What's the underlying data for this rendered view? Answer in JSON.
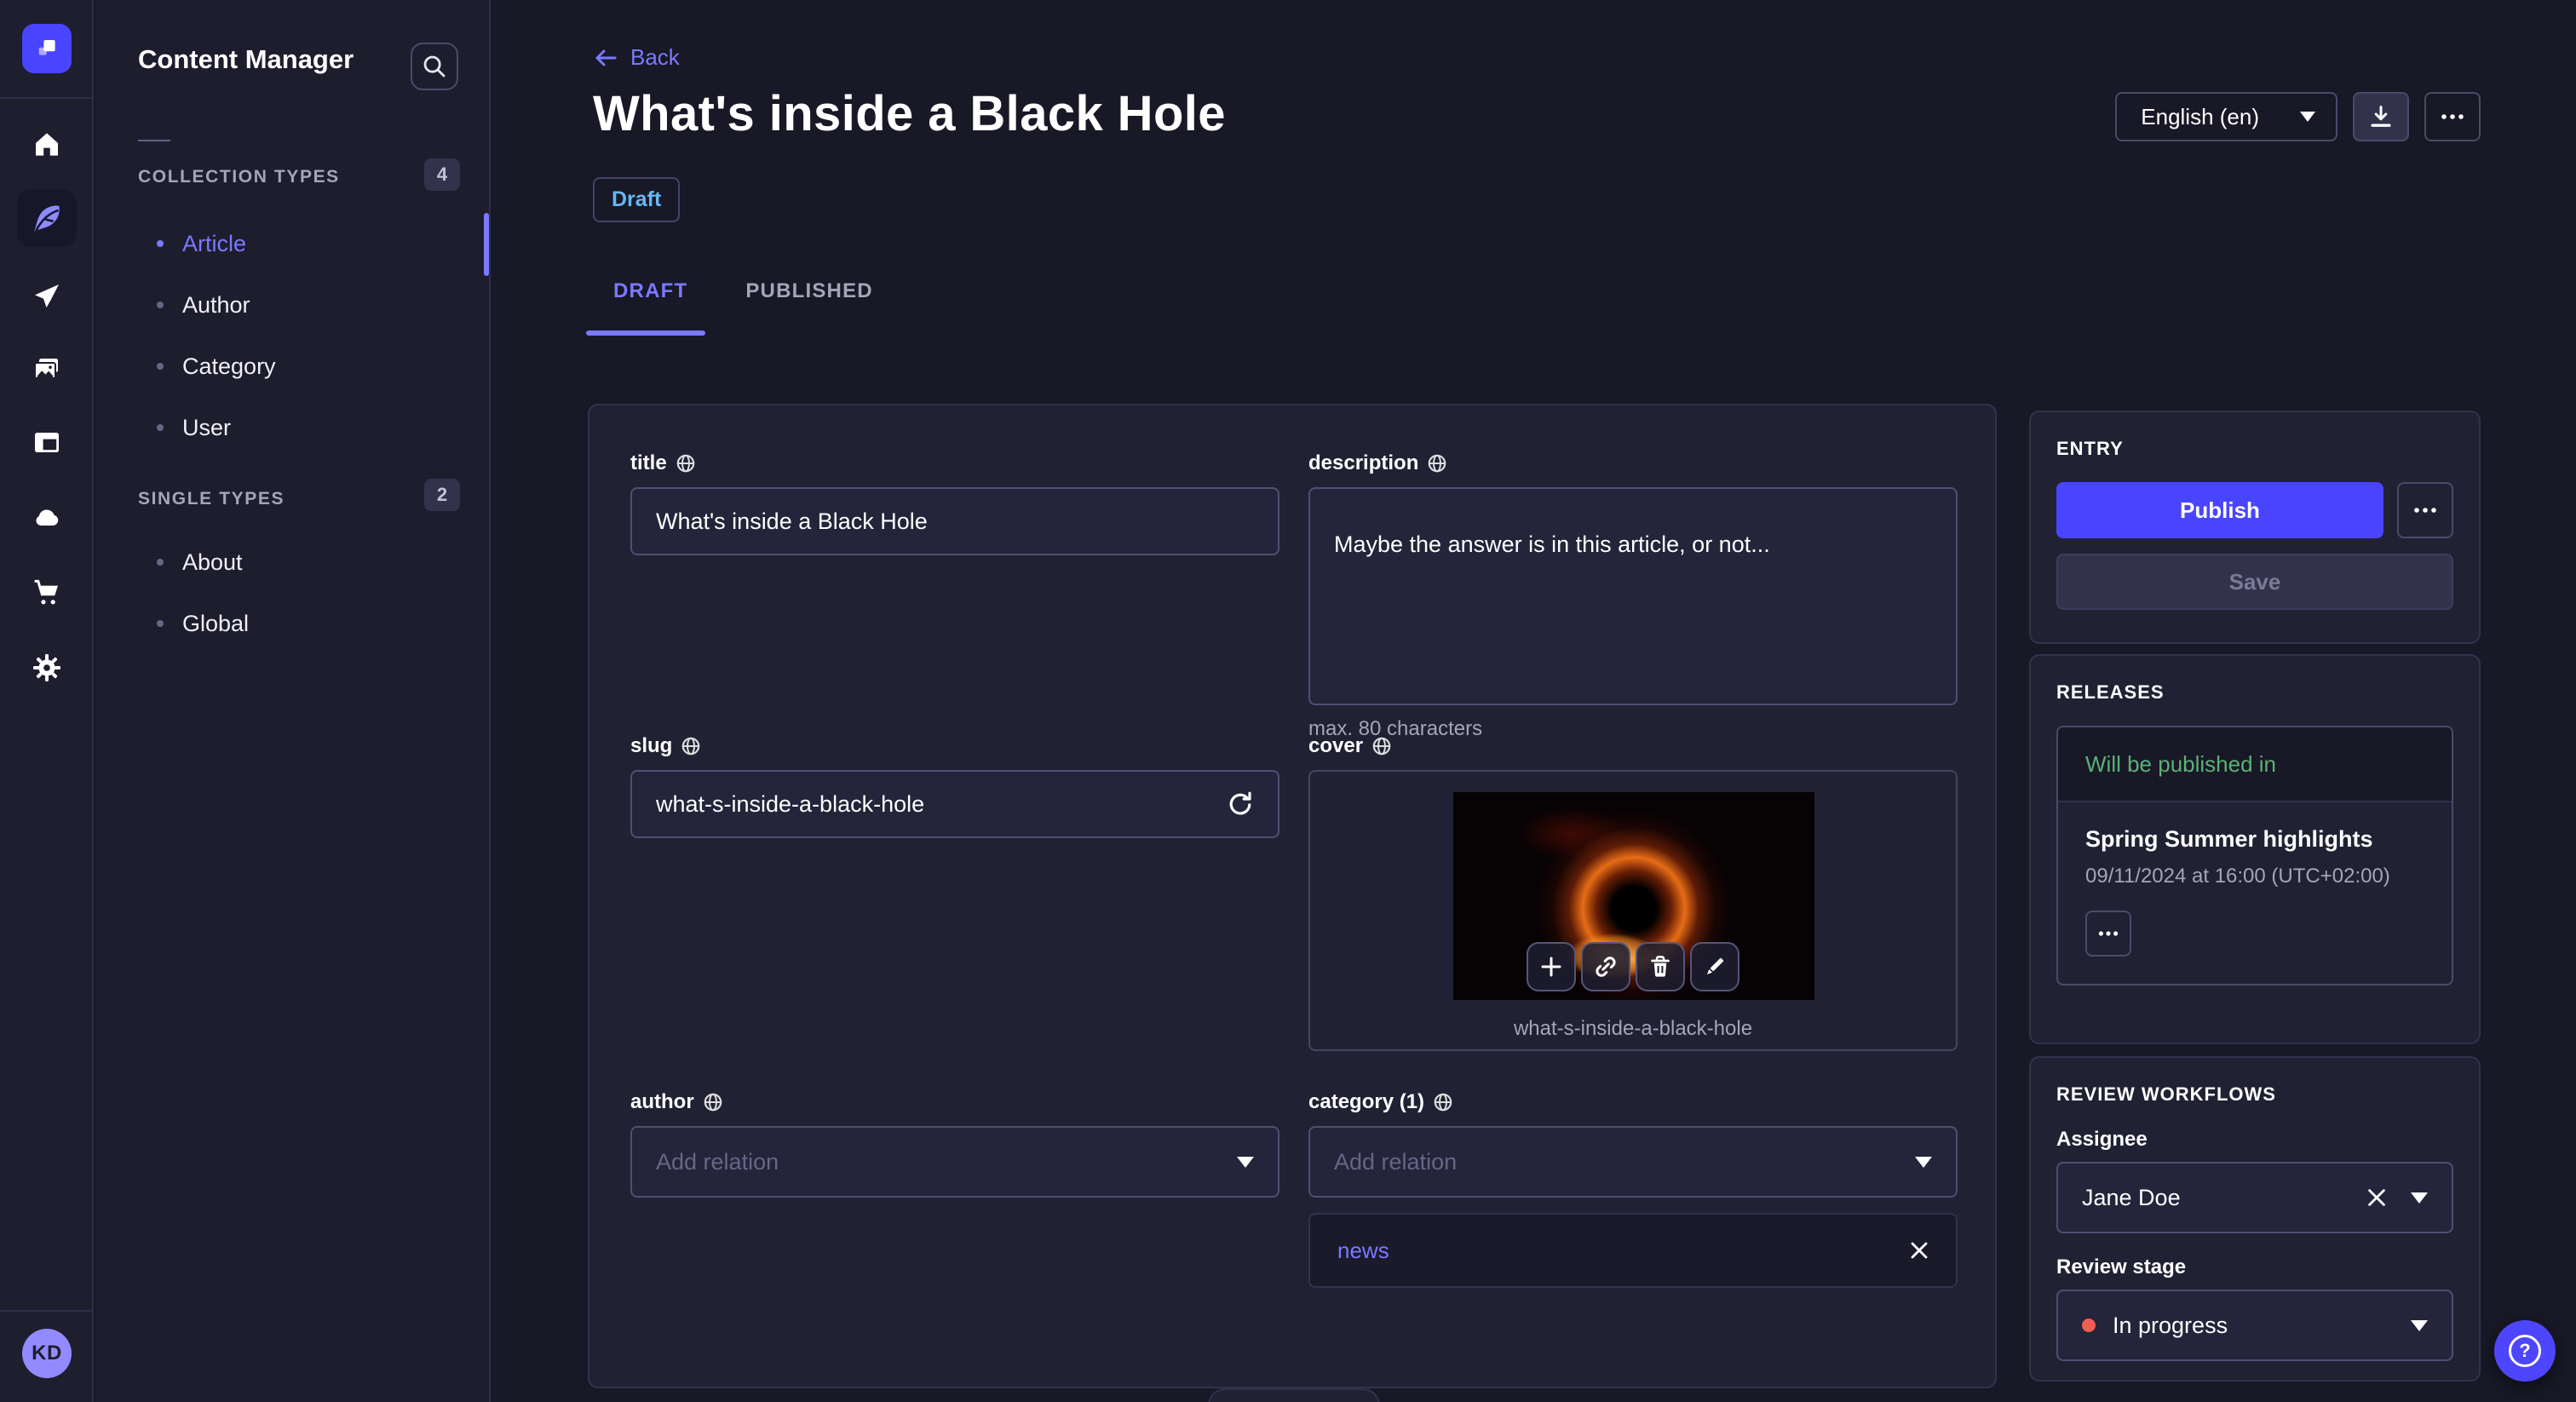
{
  "app": {
    "name": "Content Manager"
  },
  "user": {
    "initials": "KD"
  },
  "sidebar": {
    "title": "Content Manager",
    "sections": [
      {
        "label": "COLLECTION TYPES",
        "badge": "4",
        "items": [
          {
            "label": "Article"
          },
          {
            "label": "Author"
          },
          {
            "label": "Category"
          },
          {
            "label": "User"
          }
        ]
      },
      {
        "label": "SINGLE TYPES",
        "badge": "2",
        "items": [
          {
            "label": "About"
          },
          {
            "label": "Global"
          }
        ]
      }
    ]
  },
  "header": {
    "back": "Back",
    "title": "What's inside a Black Hole",
    "status": "Draft",
    "locale": "English (en)"
  },
  "tabs": [
    {
      "label": "DRAFT"
    },
    {
      "label": "PUBLISHED"
    }
  ],
  "form": {
    "title": {
      "label": "title",
      "value": "What's inside a Black Hole"
    },
    "description": {
      "label": "description",
      "value": "Maybe the answer is in this article, or not...",
      "hint": "max. 80 characters"
    },
    "slug": {
      "label": "slug",
      "value": "what-s-inside-a-black-hole"
    },
    "cover": {
      "label": "cover",
      "caption": "what-s-inside-a-black-hole"
    },
    "author": {
      "label": "author",
      "placeholder": "Add relation"
    },
    "category": {
      "label": "category (1)",
      "placeholder": "Add relation",
      "relations": [
        {
          "label": "news"
        }
      ]
    }
  },
  "entry": {
    "heading": "ENTRY",
    "publish_label": "Publish",
    "save_label": "Save"
  },
  "releases": {
    "heading": "RELEASES",
    "status": "Will be published in",
    "name": "Spring Summer highlights",
    "date": "09/11/2024 at 16:00 (UTC+02:00)"
  },
  "review": {
    "heading": "REVIEW WORKFLOWS",
    "assignee_label": "Assignee",
    "assignee_value": "Jane Doe",
    "stage_label": "Review stage",
    "stage_value": "In progress"
  },
  "help": {
    "label": "?"
  },
  "icons": {
    "rail": [
      "home-icon",
      "feather-icon",
      "paper-plane-icon",
      "media-library-icon",
      "content-type-builder-icon",
      "cloud-icon",
      "marketplace-cart-icon",
      "settings-gear-icon"
    ],
    "other": [
      "search-icon",
      "back-arrow-icon",
      "caret-down-icon",
      "download-icon",
      "more-dots-icon",
      "globe-i18n-icon",
      "refresh-icon",
      "plus-icon",
      "link-icon",
      "trash-icon",
      "pencil-icon",
      "close-x-icon",
      "question-icon"
    ]
  },
  "colors": {
    "accent": "#4945ff",
    "link": "#7b79ff",
    "draft_status": "#66b7f1",
    "success": "#5cb176",
    "danger": "#ee5e52",
    "page_bg": "#181826",
    "card_bg": "#212134"
  }
}
